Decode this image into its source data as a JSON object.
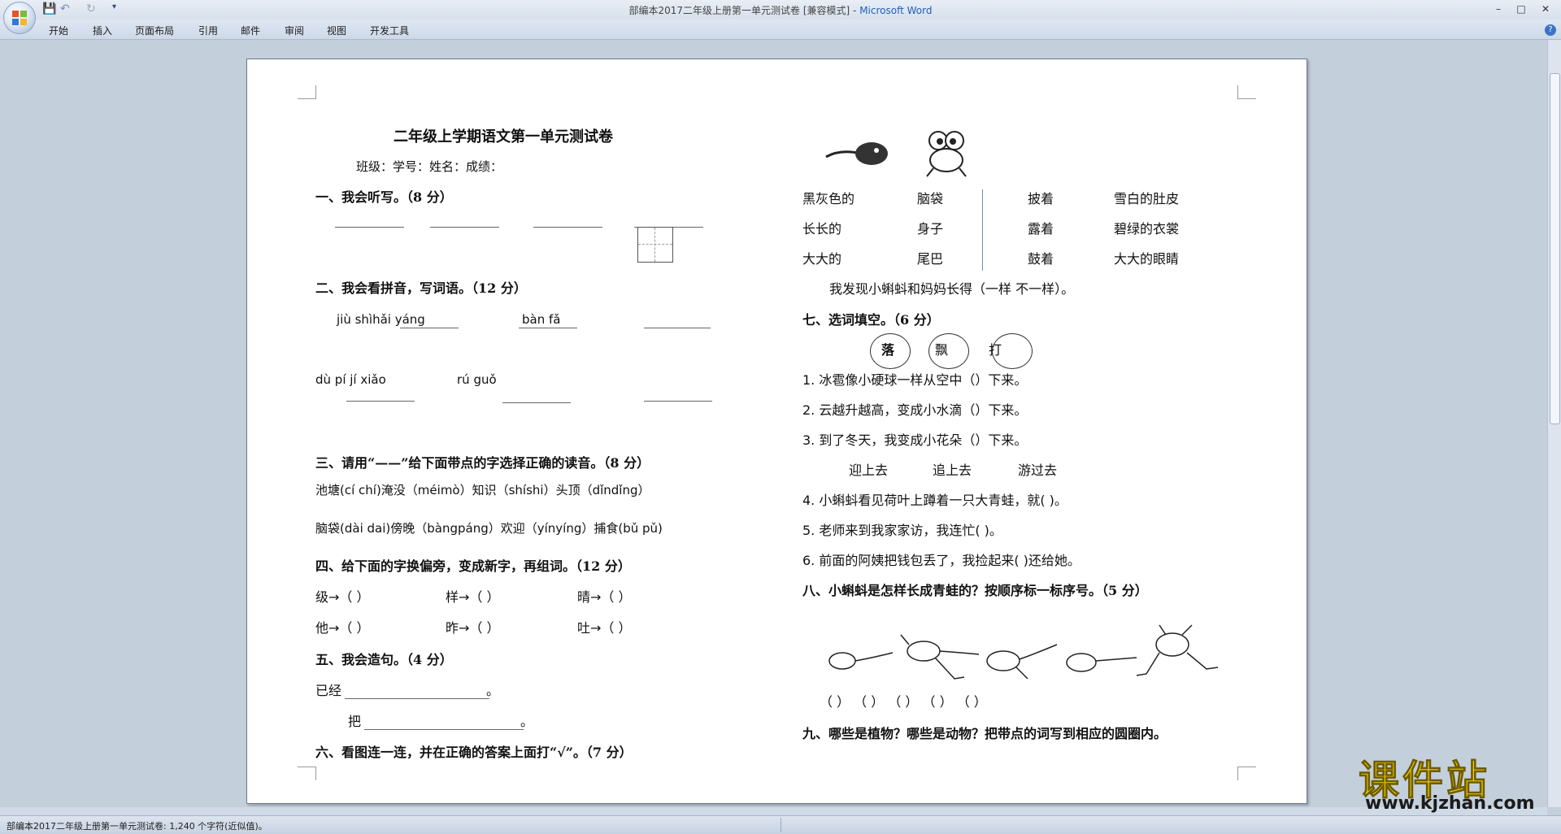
{
  "window": {
    "title": "部编本2017二年级上册第一单元测试卷 [兼容模式] - ",
    "app_name": "Microsoft Word",
    "quick_access": [
      "save-icon",
      "undo-icon",
      "redo-icon",
      "customize-icon"
    ]
  },
  "ribbon": {
    "tabs": [
      "开始",
      "插入",
      "页面布局",
      "引用",
      "邮件",
      "审阅",
      "视图",
      "开发工具"
    ]
  },
  "document": {
    "title": "二年级上学期语文第一单元测试卷",
    "info": "班级：学号：姓名：成绩：",
    "s1": "一、我会听写。（8 分）",
    "s2": "二、我会看拼音，写词语。（12 分）",
    "py_row1": [
      "jiù  shìhǎi yáng",
      "bàn fǎ"
    ],
    "py_row2": [
      "dù   pí  jí  xiǎo",
      "rú guǒ"
    ],
    "s3": "三、请用“——”给下面带点的字选择正确的读音。（8 分）",
    "s3_line1": "池塘(cí chí)淹没（méimò）知识（shíshi）头顶（dǐndǐng）",
    "s3_line2": "脑袋(dài  dai)傍晚（bàngpáng）欢迎（yínyíng）捕食(bǔ  pǔ)",
    "s4": "四、给下面的字换偏旁，变成新字，再组词。（12 分）",
    "s4_row1": [
      "级→（      ）",
      "样→（      ）",
      "晴→（      ）"
    ],
    "s4_row2": [
      "他→（      ）",
      "昨→（      ）",
      "吐→（      ）"
    ],
    "s5": "五、我会造句。（4 分）",
    "s5_a": "已经",
    "s5_b": "把",
    "s5_end": "。",
    "s6": "六、看图连一连，并在正确的答案上面打“√”。（7 分）",
    "match_left": [
      [
        "黑灰色的",
        "脑袋"
      ],
      [
        "长长的",
        "身子"
      ],
      [
        "大大的",
        "尾巴"
      ]
    ],
    "match_right": [
      [
        "披着",
        "雪白的肚皮"
      ],
      [
        "露着",
        "碧绿的衣裳"
      ],
      [
        "鼓着",
        "大大的眼睛"
      ]
    ],
    "s6_found": "我发现小蝌蚪和妈妈长得（一样   不一样）。",
    "s7": "七、选词填空。（6 分）",
    "apples": [
      "落",
      "飘",
      "打"
    ],
    "s7_items": [
      "1. 冰雹像小硬球一样从空中（）下来。",
      "2. 云越升越高，变成小水滴（）下来。",
      "3. 到了冬天，我变成小花朵（）下来。"
    ],
    "s7_words": [
      "迎上去",
      "追上去",
      "游过去"
    ],
    "s7_items2": [
      "4. 小蝌蚪看见荷叶上蹲着一只大青蛙，就(          )。",
      "5. 老师来到我家家访，我连忙(          )。",
      "6. 前面的阿姨把钱包丢了，我捡起来(          )还给她。"
    ],
    "s8": "八、小蝌蚪是怎样长成青蛙的？按顺序标一标序号。（5 分）",
    "s8_brackets": "（       ）   （       ）   （       ）   （       ）   （       ）",
    "s9": "九、哪些是植物？哪些是动物？把带点的词写到相应的圆圈内。"
  },
  "status": {
    "text": "部编本2017二年级上册第一单元测试卷: 1,240 个字符(近似值)。"
  },
  "watermark": {
    "brand": "课件站",
    "url": "www.kjzhan.com"
  }
}
